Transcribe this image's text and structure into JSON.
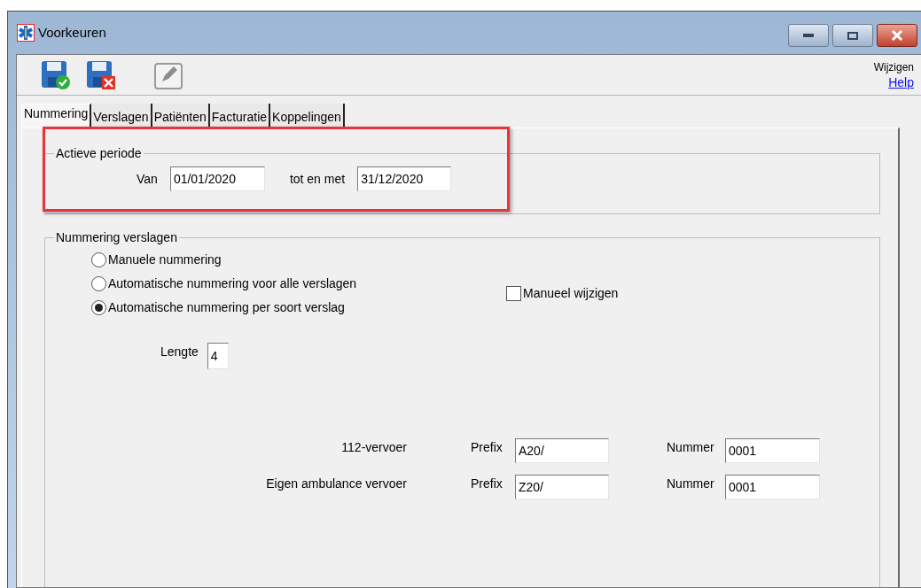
{
  "window": {
    "title": "Voorkeuren"
  },
  "toolbar": {
    "right_label": "Wijzigen",
    "help_link": "Help"
  },
  "tabs": [
    {
      "label": "Nummering",
      "selected": true
    },
    {
      "label": "Verslagen",
      "selected": false
    },
    {
      "label": "Patiënten",
      "selected": false
    },
    {
      "label": "Facturatie",
      "selected": false
    },
    {
      "label": "Koppelingen",
      "selected": false
    }
  ],
  "period": {
    "title": "Actieve periode",
    "highlighted": true,
    "from_label": "Van",
    "from_value": "01/01/2020",
    "to_label": "tot en met",
    "to_value": "31/12/2020"
  },
  "numbering": {
    "title": "Nummering verslagen",
    "options": [
      {
        "label": "Manuele nummering",
        "selected": false
      },
      {
        "label": "Automatische nummering voor alle verslagen",
        "selected": false
      },
      {
        "label": "Automatische nummering per soort verslag",
        "selected": true
      }
    ],
    "manual_edit": {
      "label": "Manueel wijzigen",
      "checked": false
    },
    "length_label": "Lengte",
    "length_value": "4",
    "rows": [
      {
        "name": "112-vervoer",
        "prefix_label": "Prefix",
        "prefix": "A20/",
        "number_label": "Nummer",
        "number": "0001"
      },
      {
        "name": "Eigen ambulance vervoer",
        "prefix_label": "Prefix",
        "prefix": "Z20/",
        "number_label": "Nummer",
        "number": "0001"
      }
    ]
  }
}
